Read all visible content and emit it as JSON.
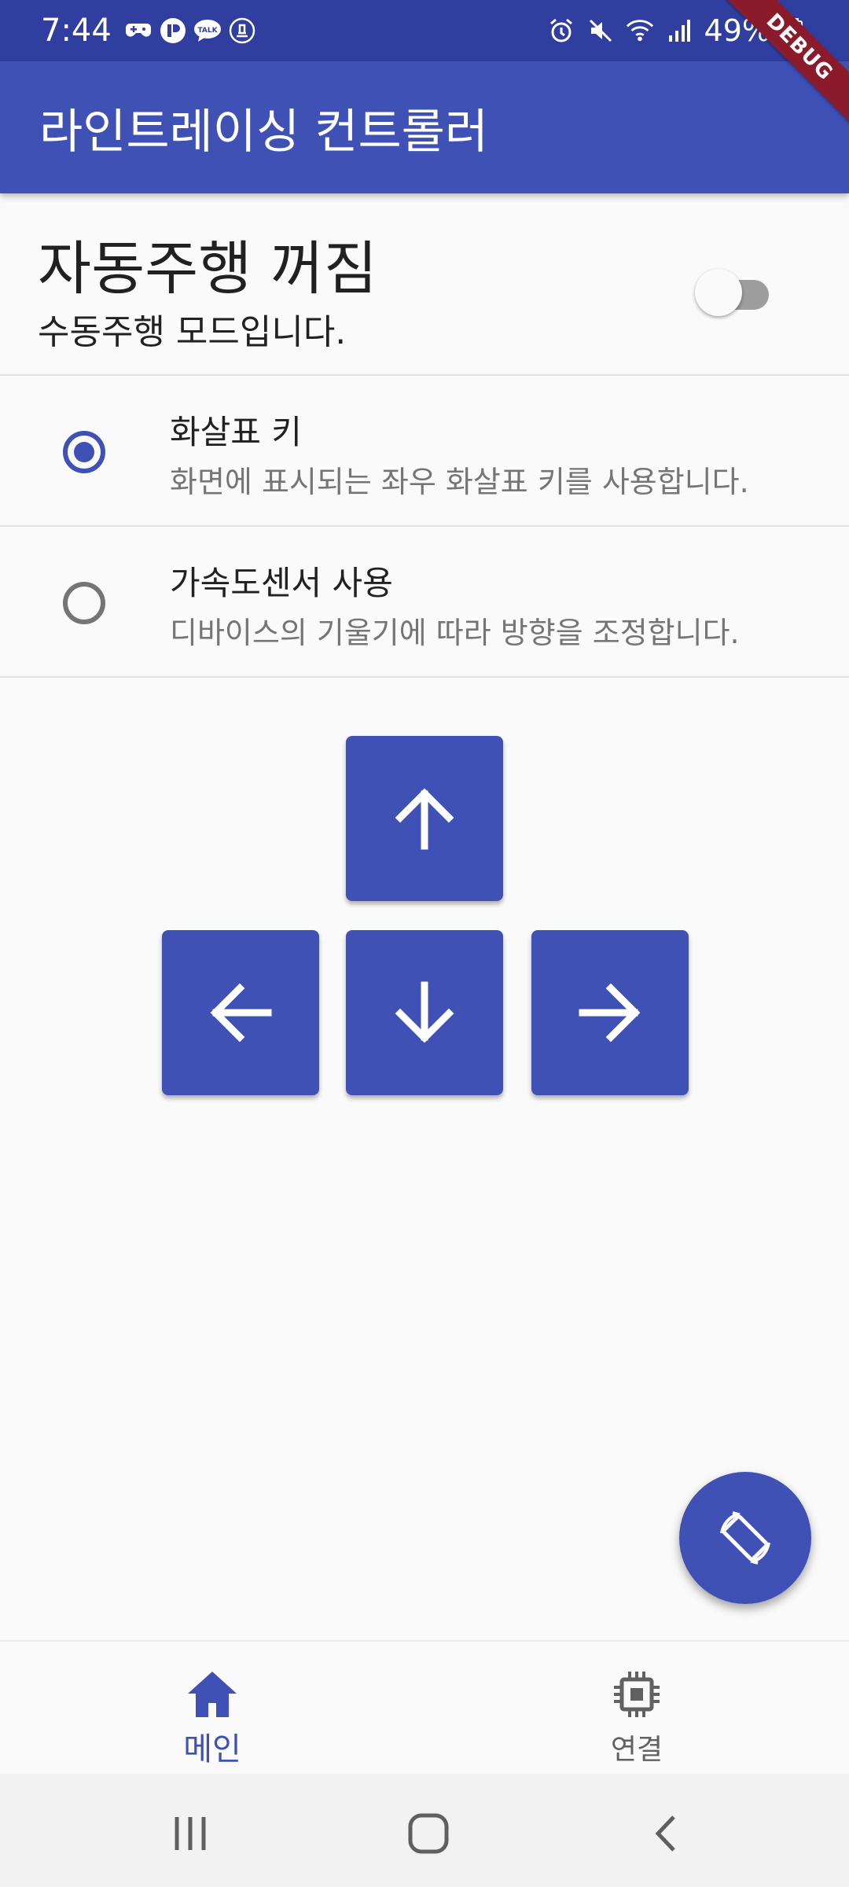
{
  "status_bar": {
    "time": "7:44",
    "battery": "49%",
    "icons_left": [
      "game-controller-icon",
      "app-icon",
      "talk-icon",
      "badge-icon"
    ],
    "icons_right": [
      "alarm-icon",
      "mute-icon",
      "wifi-icon",
      "signal-icon",
      "battery-icon"
    ]
  },
  "debug_banner": "DEBUG",
  "app_bar": {
    "title": "라인트레이싱 컨트롤러"
  },
  "autodrive": {
    "title": "자동주행 꺼짐",
    "subtitle": "수동주행 모드입니다.",
    "enabled": false
  },
  "control_mode": {
    "options": [
      {
        "title": "화살표 키",
        "subtitle": "화면에 표시되는 좌우 화살표 키를 사용합니다.",
        "selected": true
      },
      {
        "title": "가속도센서 사용",
        "subtitle": "디바이스의 기울기에 따라 방향을 조정합니다.",
        "selected": false
      }
    ]
  },
  "arrow_keys": [
    "arrow-up-icon",
    "arrow-left-icon",
    "arrow-down-icon",
    "arrow-right-icon"
  ],
  "fab": {
    "icon": "screen-rotation-icon"
  },
  "bottom_nav": {
    "items": [
      {
        "label": "메인",
        "icon": "home-icon",
        "active": true
      },
      {
        "label": "연결",
        "icon": "chip-icon",
        "active": false
      }
    ]
  },
  "colors": {
    "primary": "#3f51b5",
    "primary_dark": "#303f9f",
    "background": "#fafafa",
    "debug_ribbon": "#8b1b2b"
  }
}
